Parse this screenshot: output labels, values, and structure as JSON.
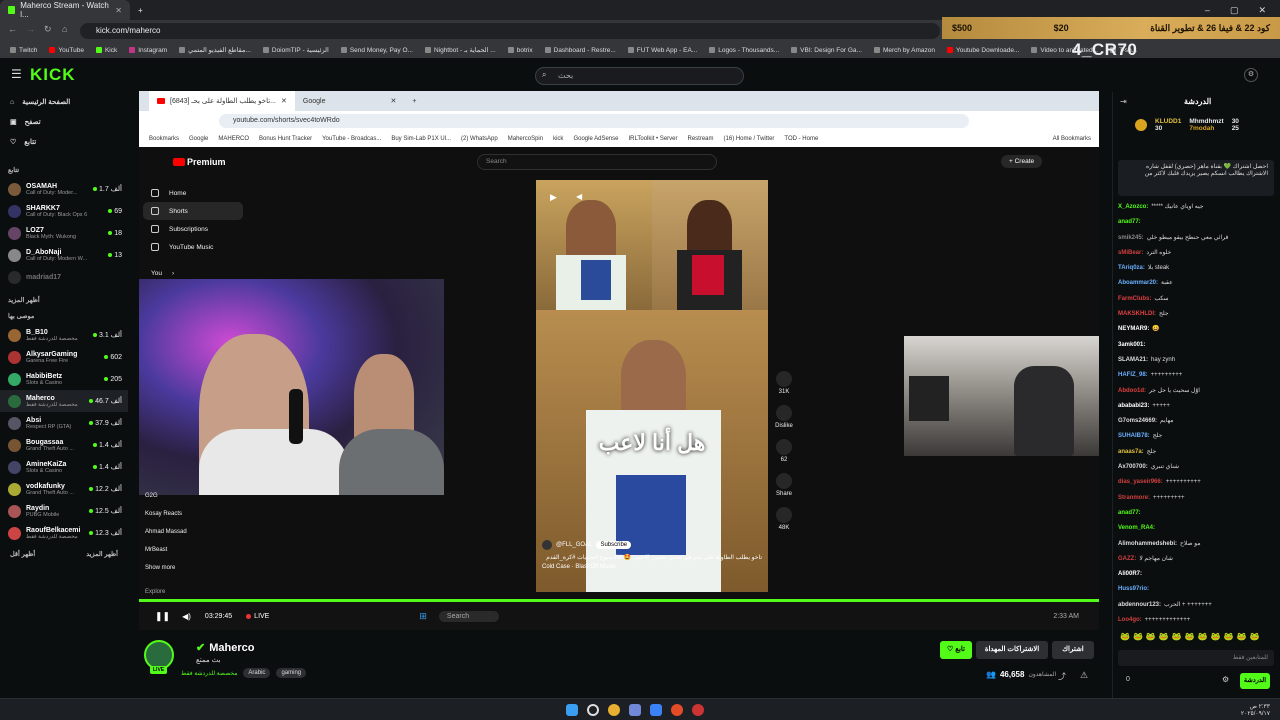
{
  "browser": {
    "tab_title": "Maherco Stream - Watch l...",
    "url": "kick.com/maherco",
    "bookmarks": [
      "Twitch",
      "YouTube",
      "Kick",
      "Instagram",
      "مقاطع الفيديو المتمي...",
      "DoiomTIP - الرئيسية",
      "Send Money, Pay O...",
      "Nightbot - الحماية بـ ...",
      "botrix",
      "Dashboard - Restre...",
      "FUT Web App - EA...",
      "Logos - Thousands...",
      "VBI: Design For Ga...",
      "Merch by Amazon",
      "Youtube Downloade...",
      "Video to animated...",
      "T-sh...",
      "All Bookmarks"
    ]
  },
  "banner": {
    "price_left": "$20",
    "price_right": "$500",
    "text": "كود 22 & فيفا 26 & تطوير القناة",
    "sub": "4_CR70"
  },
  "kick": {
    "logo": "KICK",
    "search_placeholder": "بحث",
    "nav": [
      "الصفحة الرئيسية",
      "تصفح",
      "تتابع"
    ],
    "following_header": "تتابع",
    "show_more": "أظهر المزيد",
    "recommended_header": "موصى بها",
    "show_less": "أظهر أقل",
    "following": [
      {
        "name": "OSAMAH",
        "cat": "Call of Duty: Moder...",
        "v": "1.7 ألف"
      },
      {
        "name": "SHARKK7",
        "cat": "Call of Duty: Black Ops 6",
        "v": "69"
      },
      {
        "name": "LOZ7",
        "cat": "Black Myth: Wukong",
        "v": "18"
      },
      {
        "name": "D_AboNaji",
        "cat": "Call of Duty: Modern W...",
        "v": "13"
      },
      {
        "name": "madriad17",
        "cat": "",
        "v": ""
      }
    ],
    "recommended": [
      {
        "name": "B_B10",
        "cat": "مخصصة للدردشة فقط",
        "v": "3.1 ألف"
      },
      {
        "name": "AlkysarGaming",
        "cat": "Garena Free Fire",
        "v": "602"
      },
      {
        "name": "HabibiBetz",
        "cat": "Slots & Casino",
        "v": "205"
      },
      {
        "name": "Maherco",
        "cat": "مخصصة للدردشة فقط",
        "v": "46.7 ألف"
      },
      {
        "name": "Absi",
        "cat": "Respect RP (GTA)",
        "v": "37.9 ألف"
      },
      {
        "name": "Bougassaa",
        "cat": "Grand Theft Auto ...",
        "v": "1.4 ألف"
      },
      {
        "name": "AmineKaiZa",
        "cat": "Slots & Casino",
        "v": "1.4 ألف"
      },
      {
        "name": "vodkafunky",
        "cat": "Grand Theft Auto ...",
        "v": "12.2 ألف"
      },
      {
        "name": "Raydin",
        "cat": "PUBG Mobile",
        "v": "12.5 ألف"
      },
      {
        "name": "RaoufBelkacemi",
        "cat": "مخصصة للدردشة فقط",
        "v": "12.3 ألف"
      }
    ]
  },
  "inner": {
    "tab1": "[6843] تاخو يطلب الطاولة على بحـ...",
    "tab2": "Google",
    "url": "youtube.com/shorts/svec4toWRdo",
    "bookmarks": [
      "Bookmarks",
      "Google",
      "MAHERCO",
      "Bonus Hunt Tracker",
      "YouTube - Broadcas...",
      "Buy Sim-Lab P1X Ul...",
      "(2) WhatsApp",
      "MahercoSpin",
      "kick",
      "Google AdSense",
      "IRLToolkit • Server",
      "Restream",
      "(16) Home / Twitter",
      "TOD - Home",
      "All Bookmarks"
    ],
    "yt_logo": "Premium",
    "yt_search": "Search",
    "create": "Create",
    "yt_nav": [
      "Home",
      "Shorts",
      "Subscriptions",
      "YouTube Music"
    ],
    "you": "You",
    "subs": [
      "G2G",
      "Kosay Reacts",
      "Ahmad Massad",
      "MrBeast",
      "Show more"
    ],
    "explore": "Explore",
    "caption": "هل أنا لاعب",
    "channel": "@FLL_GOAL",
    "subscribe": "Subscribe",
    "short_desc": "تاخو يطلب الطاولة على بحر في تحدي تخمين الاعبين 🤩 #الاسبوع #تحديات #كرة_القدم",
    "music": "Cold Case · Blast Off Music",
    "likes": "31K",
    "dislike": "Dislike",
    "comments": "62",
    "share": "Share",
    "remix": "48K"
  },
  "player": {
    "time": "03:29:45",
    "live": "LIVE",
    "search": "Search",
    "clock": "2:33 AM"
  },
  "stream": {
    "name": "Maherco",
    "title": "بث ممتع",
    "category": "مخصصة للدردشة فقط",
    "tags": [
      "Arabic",
      "gaming"
    ],
    "follow": "تابع",
    "subs_btn": "الاشتراكات المهداة",
    "gift": "اشتراك",
    "viewers": "46,658",
    "viewers_label": "المشاهدون",
    "live_badge": "LIVE"
  },
  "chat": {
    "title": "الدردشة",
    "gifters": [
      {
        "name": "KLUDD1",
        "v": "30"
      },
      {
        "name": "Mhmdhmzt",
        "v": ""
      },
      {
        "name": "7modah",
        "v": "25"
      }
    ],
    "pinned": "احصل اشتراك 💚 بقناة ماهر (حصري) لقفل شاره الاشتراك يطالب انسكم يصير يزيدك قلبك لاكثر من",
    "messages": [
      [
        "X_Azozco:",
        "***** جيه اوياي عانيك",
        "#53fc18"
      ],
      [
        "anad77:",
        "",
        "#53fc18"
      ],
      [
        "smik245:",
        "قرائي معي حنطح بيقو ميطو خلي",
        "#888"
      ],
      [
        "sMiBear:",
        "خلوه الترد",
        "#d04040"
      ],
      [
        "TAriq0za:",
        "بلا steak",
        "#6ab0ff"
      ],
      [
        "Aboammar20:",
        "عقبة",
        "#6ab0ff"
      ],
      [
        "FarmClubs:",
        "سكب",
        "#e04040"
      ],
      [
        "MAKSKHLDI:",
        "جلج",
        "#e04040"
      ],
      [
        "NEYMAR9:",
        "😀",
        "#fff"
      ],
      [
        "3amk001:",
        "",
        "#fff"
      ],
      [
        "SLAMA21:",
        "hay zynh",
        "#ddd"
      ],
      [
        "HAFIZ_98:",
        "+++++++++",
        "#6ab0ff"
      ],
      [
        "Abdoo1d:",
        "اوّل سحيث يا حل جر",
        "#e04040"
      ],
      [
        "abababi23:",
        "+++++",
        "#fff"
      ],
      [
        "G7oms24669:",
        "مهايم",
        "#ddd"
      ],
      [
        "SUHAIB78:",
        "جلج",
        "#6ab0ff"
      ],
      [
        "anaas7a:",
        "جلج",
        "#e0c040"
      ],
      [
        "Ax700700:",
        "شناي تنبري",
        "#ddd"
      ],
      [
        "dias_yaseir966:",
        "++++++++++",
        "#d04040"
      ],
      [
        "Stranmore:",
        "+++++++++",
        "#d04040"
      ],
      [
        "anad77:",
        "",
        "#53fc18"
      ],
      [
        "Venom_RA4:",
        "",
        "#53fc18"
      ],
      [
        "Alimohammedshebi:",
        "مو صلاح",
        "#ddd"
      ],
      [
        "GAZZ:",
        "شان مهاجم لا",
        "#d04040"
      ],
      [
        "Ali00R7:",
        "",
        "#fff"
      ],
      [
        "Huss97rio:",
        "",
        "#6ab0ff"
      ],
      [
        "abdennour123:",
        "الحرب + +++++++",
        "#ddd"
      ],
      [
        "Loo4go:",
        "+++++++++++++",
        "#d04040"
      ]
    ],
    "emotes": "🐸🐸🐸🐸🐸🐸🐸🐸🐸🐸🐸",
    "input_placeholder": "للمتابعين فقط",
    "send": "الدردشة",
    "count": "0"
  },
  "taskbar": {
    "time": "٢:٣٣ ص",
    "date": "٢٠٢٥/٠٩/١٧"
  },
  "colors": {
    "kick_green": "#53fc18",
    "bg": "#0b0e0f"
  }
}
